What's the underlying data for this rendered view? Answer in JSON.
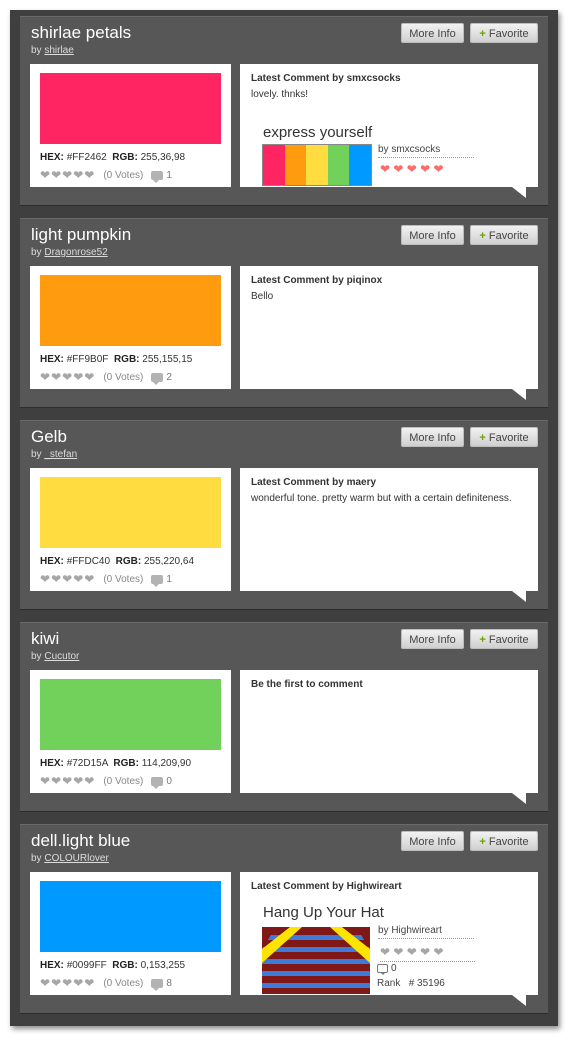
{
  "buttons": {
    "more_info": "More Info",
    "favorite": "Favorite",
    "plus": "+"
  },
  "labels": {
    "by": "by",
    "hex": "HEX:",
    "rgb": "RGB:",
    "latest_comment_by": "Latest Comment by",
    "rank": "Rank"
  },
  "colors": [
    {
      "title": "shirlae petals",
      "author": "shirlae",
      "hex_value": "#FF2462",
      "swatch": "#ff2462",
      "rgb": "255,36,98",
      "votes": "(0 Votes)",
      "comments": "1",
      "comment": {
        "author": "smxcsocks",
        "text": "lovely. thnks!"
      },
      "palette": {
        "title": "express yourself",
        "by": "by smxcsocks",
        "hearts": "❤ ❤ ❤ ❤ ❤",
        "stripes": [
          "#ff2462",
          "#ff9b0f",
          "#ffdc40",
          "#72d15a",
          "#0099ff"
        ]
      }
    },
    {
      "title": "light pumpkin",
      "author": "Dragonrose52",
      "hex_value": "#FF9B0F",
      "swatch": "#ff9b0f",
      "rgb": "255,155,15",
      "votes": "(0 Votes)",
      "comments": "2",
      "comment": {
        "author": "piqinox",
        "text": "Bello"
      }
    },
    {
      "title": "Gelb",
      "author": "_stefan",
      "hex_value": "#FFDC40",
      "swatch": "#ffdc40",
      "rgb": "255,220,64",
      "votes": "(0 Votes)",
      "comments": "1",
      "comment": {
        "author": "maery",
        "text": "wonderful tone. pretty warm but with a certain definiteness."
      }
    },
    {
      "title": "kiwi",
      "author": "Cucutor",
      "hex_value": "#72D15A",
      "swatch": "#72d15a",
      "rgb": "114,209,90",
      "votes": "(0 Votes)",
      "comments": "0",
      "first_comment": "Be the first to comment"
    },
    {
      "title": "dell.light blue",
      "author": "COLOURlover",
      "hex_value": "#0099FF",
      "swatch": "#0099ff",
      "rgb": "0,153,255",
      "votes": "(0 Votes)",
      "comments": "8",
      "comment": {
        "author": "Highwireart"
      },
      "pattern": {
        "title": "Hang Up Your Hat",
        "by": "by Highwireart",
        "hearts": "❤ ❤ ❤ ❤ ❤",
        "comments": "0",
        "rank": "# 35196",
        "bg": "#801818",
        "stripe": "#3e7bd8",
        "chevron": "#ffe400"
      }
    }
  ]
}
